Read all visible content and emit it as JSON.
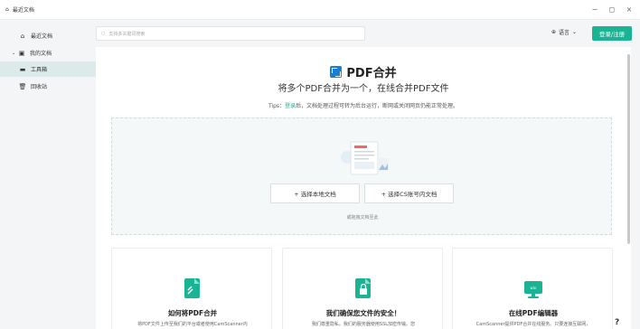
{
  "window": {
    "title": "最近文档",
    "controls": [
      "−",
      "◻",
      "×"
    ]
  },
  "sidebar": {
    "items": [
      {
        "label": "最近文档",
        "icon": "home-icon"
      },
      {
        "label": "我的文档",
        "icon": "folder-icon"
      },
      {
        "label": "工具箱",
        "icon": "toolbox-icon"
      },
      {
        "label": "回收站",
        "icon": "trash-icon"
      }
    ]
  },
  "header": {
    "search_placeholder": "支持多关键词搜索",
    "language": "语言",
    "login_label": "登录/注册"
  },
  "main": {
    "title": "PDF合并",
    "subtitle": "将多个PDF合并为一个，在线合并PDF文件",
    "tips_prefix": "Tips：",
    "tips_link": "登录",
    "tips_text": "后，文档处理过程可转为后台运行，断网或关闭网页仍能正常处理。",
    "upload_local": "+ 选择本地文档",
    "upload_cs": "+ 选择CS账号内文档",
    "drop_hint": "或拖拽文档至此"
  },
  "cards": [
    {
      "title": "如何将PDF合并",
      "desc": "将PDF文件上传至我们的平台或者使用CamScanner内",
      "icon": "document-merge-icon"
    },
    {
      "title": "我们确保您文件的安全！",
      "desc": "我们尊重隐私。我们的服务器使用SSL加密传输。您",
      "icon": "document-lock-icon"
    },
    {
      "title": "在线PDF编辑器",
      "desc": "CamScanner提供PDF合并在线服务。只要连接互联网，",
      "icon": "monitor-icon"
    }
  ],
  "help_label": "?",
  "colors": {
    "accent": "#1ab394",
    "sidebar_active": "#dcebe9",
    "logo": "#1a7fd0"
  }
}
